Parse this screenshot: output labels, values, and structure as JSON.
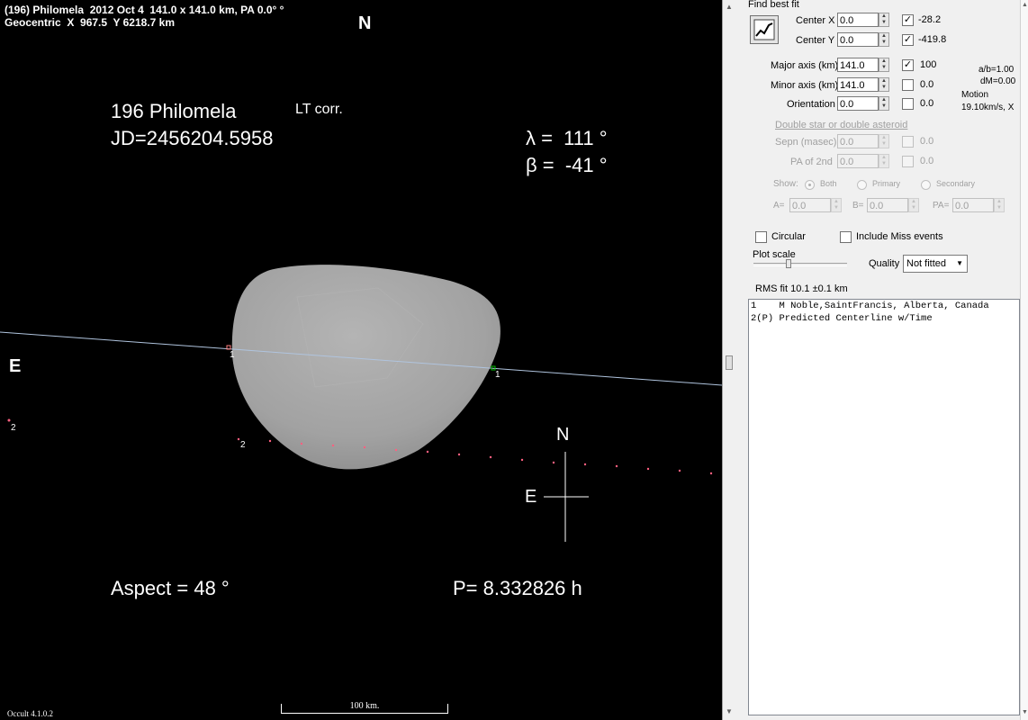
{
  "plot": {
    "header_line1": "(196) Philomela  2012 Oct 4  141.0 x 141.0 km, PA 0.0° °",
    "header_line2": "Geocentric  X  967.5  Y 6218.7 km",
    "north_top": "N",
    "east_left": "E",
    "asteroid_name": "196 Philomela",
    "lt_corr": "LT corr.",
    "jd": "JD=2456204.5958",
    "lambda": "λ =  111 °",
    "beta": "β =  -41 °",
    "aspect": "Aspect = 48 °",
    "period": "P= 8.332826 h",
    "rose_n": "N",
    "rose_e": "E",
    "chord1_left": "1",
    "chord1_right": "1",
    "chord2_left": "2",
    "chord2_edge": "2",
    "scale_label": "100 km.",
    "version": "Occult 4.1.0.2",
    "colors": {
      "chord": "#b0c4de",
      "dots": "#ff6080",
      "shape": "#a9a9a9",
      "disappear": "#ff8080",
      "reappear": "#00c000"
    }
  },
  "panel": {
    "find_best_fit": "Find best fit",
    "center_x_label": "Center X",
    "center_x": "0.0",
    "center_x_fixed": "-28.2",
    "center_y_label": "Center Y",
    "center_y": "0.0",
    "center_y_fixed": "-419.8",
    "major_label": "Major axis (km)",
    "major": "141.0",
    "major_fixed": "100",
    "minor_label": "Minor axis (km)",
    "minor": "141.0",
    "minor_fixed": "0.0",
    "orient_label": "Orientation",
    "orient": "0.0",
    "orient_fixed": "0.0",
    "ab": "a/b=1.00",
    "dm": "dM=0.00",
    "motion_label": "Motion",
    "motion": "19.10km/s, X",
    "double_title": "Double star  or  double asteroid",
    "sepn_label": "Sepn (masec)",
    "sepn": "0.0",
    "sepn_fixed": "0.0",
    "pa2_label": "PA of 2nd",
    "pa2": "0.0",
    "pa2_fixed": "0.0",
    "show_label": "Show:",
    "show_both": "Both",
    "show_primary": "Primary",
    "show_secondary": "Secondary",
    "a_label": "A=",
    "a_val": "0.0",
    "b_label": "B=",
    "b_val": "0.0",
    "pa_label": "PA=",
    "pa_val": "0.0",
    "circular": "Circular",
    "include_miss": "Include Miss events",
    "plot_scale": "Plot scale",
    "quality_label": "Quality",
    "quality": "Not fitted",
    "rms": "RMS fit  10.1 ±0.1 km",
    "observers": [
      "1    M Noble,SaintFrancis, Alberta, Canada",
      "2(P) Predicted Centerline w/Time"
    ]
  }
}
